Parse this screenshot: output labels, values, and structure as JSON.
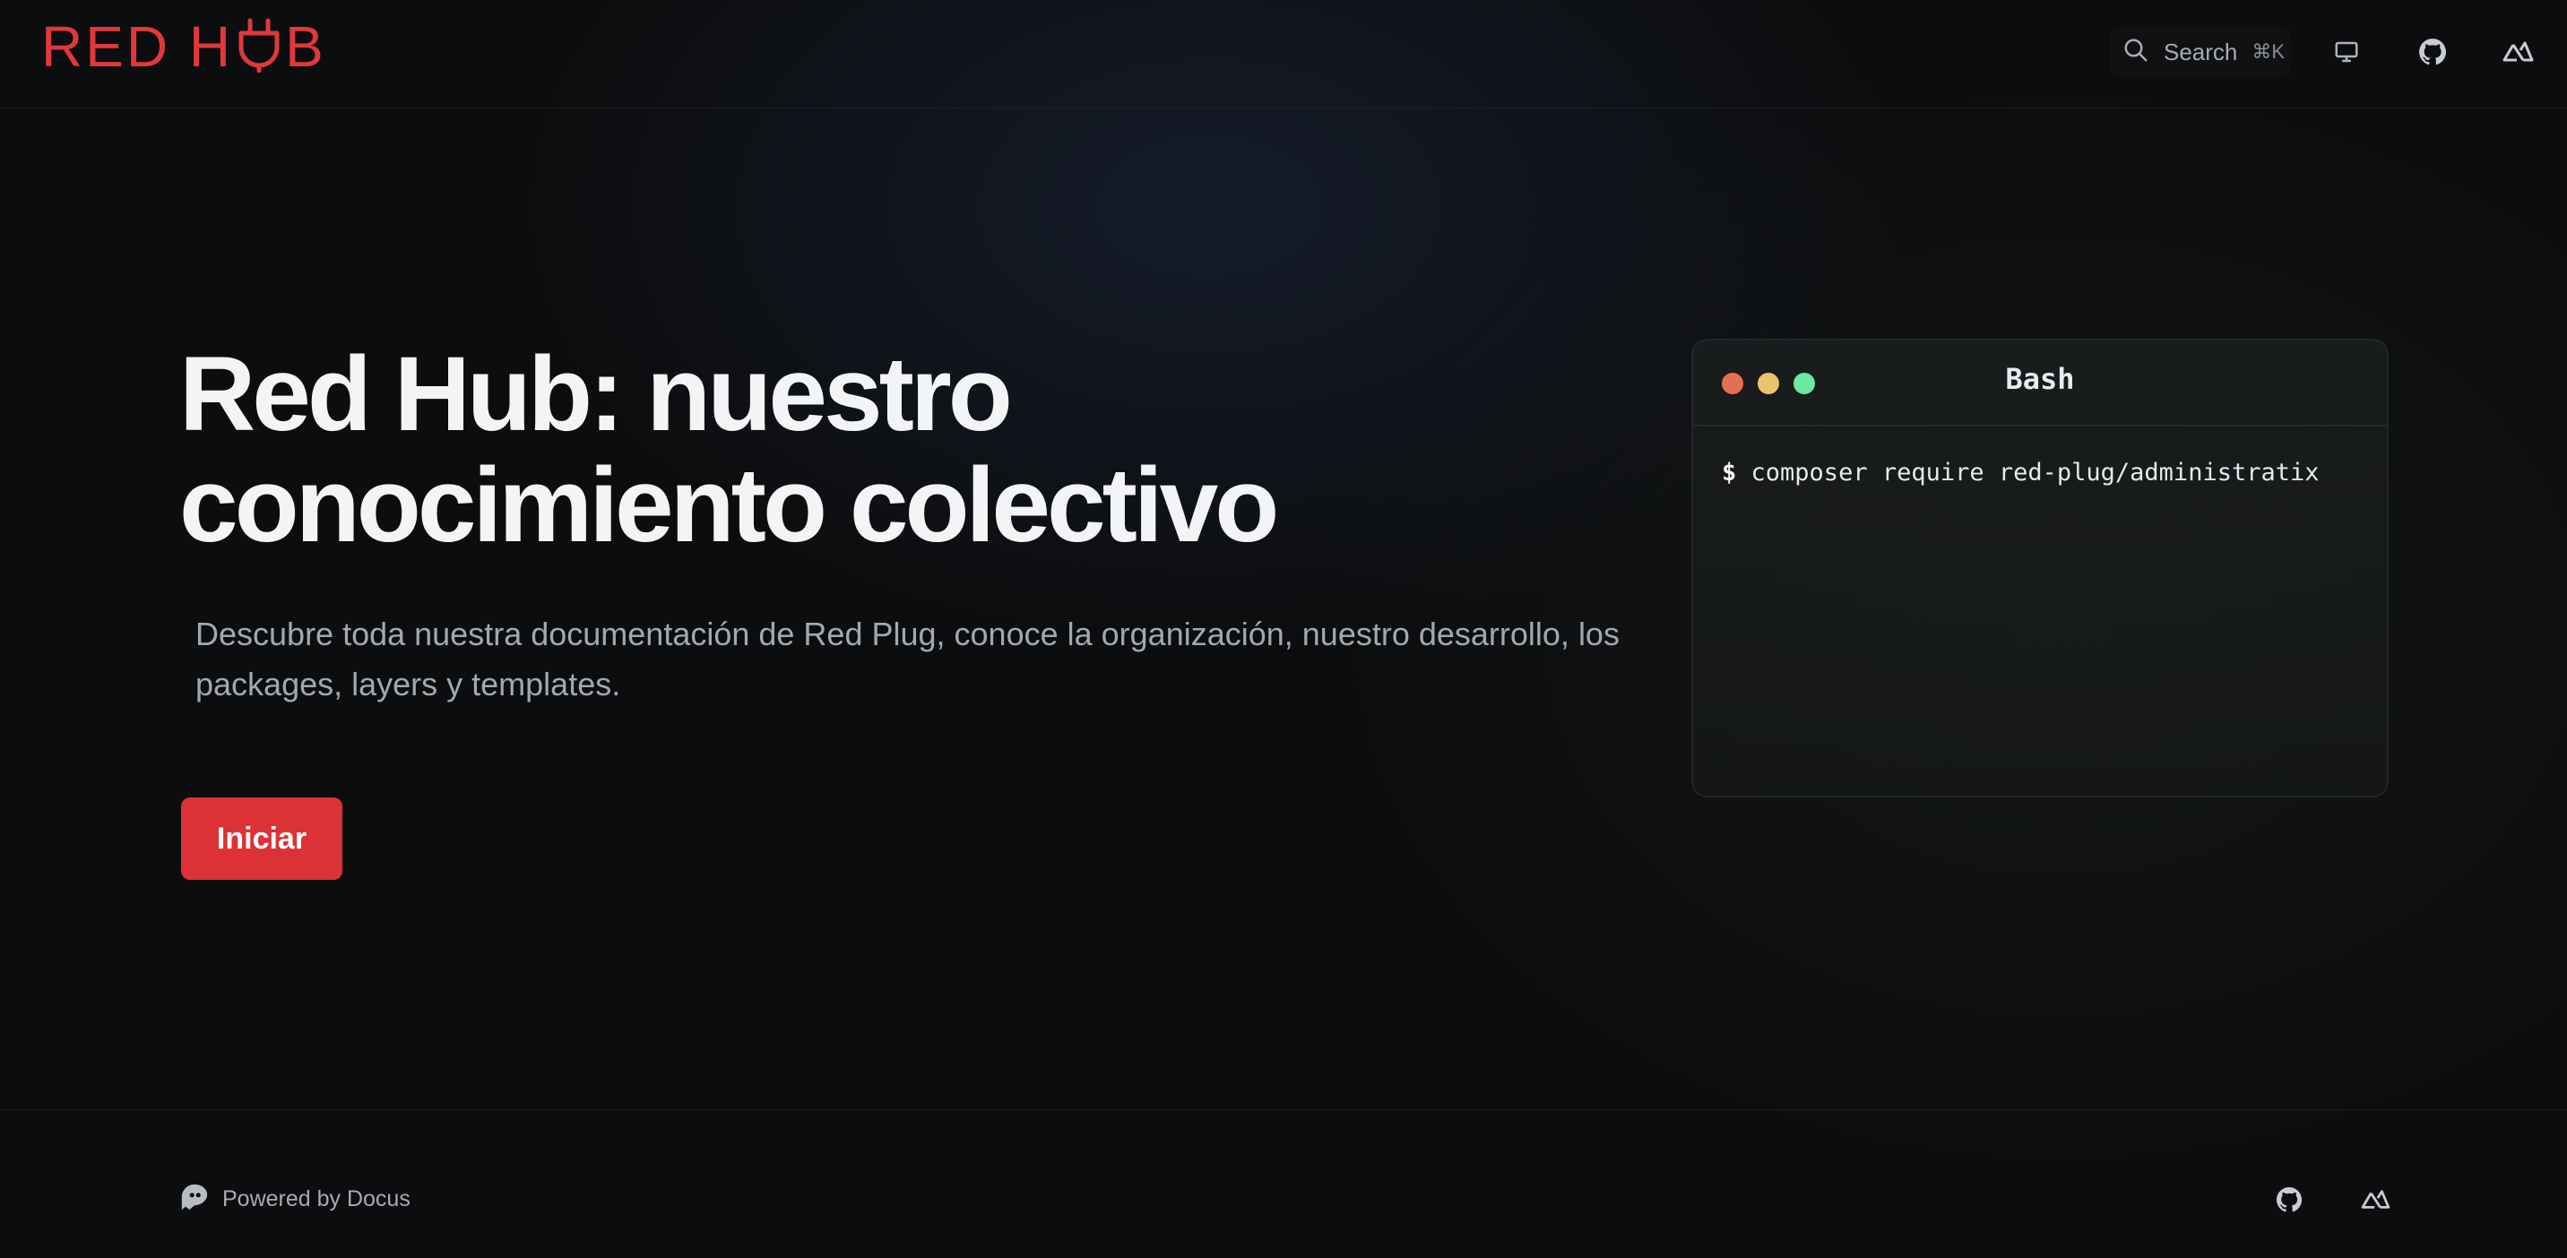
{
  "header": {
    "logo": {
      "text_left": "RED H",
      "text_right": "B",
      "color": "#e0383b"
    },
    "search": {
      "label": "Search",
      "shortcut": "⌘K",
      "icon": "search-icon"
    },
    "icons": [
      "monitor-icon",
      "github-icon",
      "nuxt-icon"
    ]
  },
  "hero": {
    "title": "Red Hub: nuestro conocimiento colectivo",
    "description": "Descubre toda nuestra documentación de Red Plug, conoce la organización, nuestro desarrollo, los packages, layers y templates.",
    "cta_label": "Iniciar",
    "cta_color": "#dc3236"
  },
  "terminal": {
    "title": "Bash",
    "prompt": "$",
    "command": "composer require red-plug/administratix",
    "dot_colors": [
      "#e76f51",
      "#e9c46a",
      "#6ee7a0"
    ]
  },
  "footer": {
    "powered_by": "Powered by Docus",
    "icons": [
      "github-icon",
      "nuxt-icon"
    ]
  }
}
